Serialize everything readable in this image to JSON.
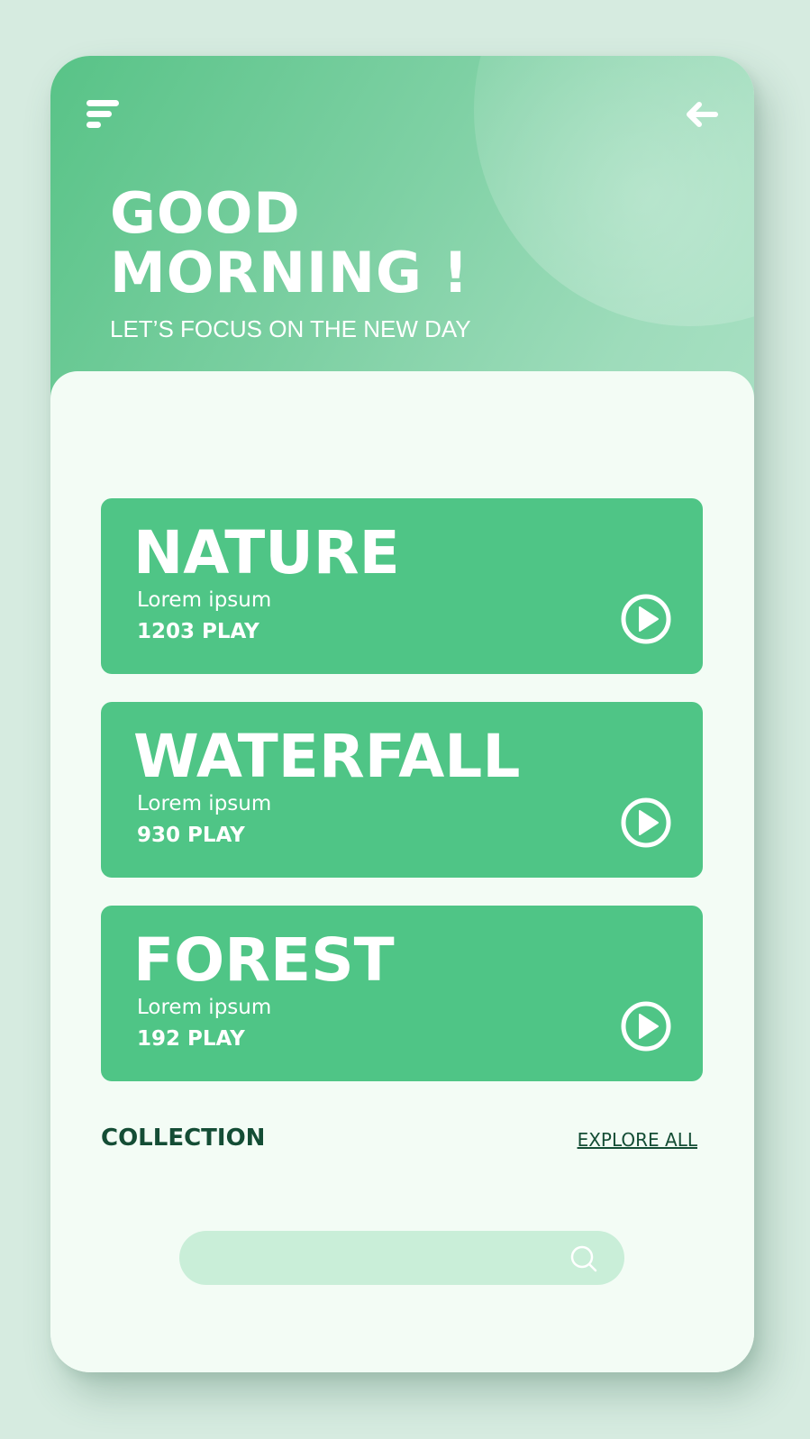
{
  "header": {
    "greeting_line1": "GOOD",
    "greeting_line2": "MORNING !",
    "subtitle": "LET’S FOCUS ON THE NEW DAY",
    "menu_icon": "menu-icon",
    "back_icon": "arrow-left-icon"
  },
  "cards": [
    {
      "title": "NATURE",
      "description": "Lorem ipsum",
      "plays": "1203 PLAY",
      "icon": "play-circle-icon"
    },
    {
      "title": "WATERFALL",
      "description": "Lorem ipsum",
      "plays": "930 PLAY",
      "icon": "play-circle-icon"
    },
    {
      "title": "FOREST",
      "description": "Lorem ipsum",
      "plays": "192 PLAY",
      "icon": "play-circle-icon"
    }
  ],
  "collection": {
    "title": "COLLECTION",
    "explore_label": "EXPLORE ALL"
  },
  "search": {
    "placeholder": "",
    "icon": "search-icon"
  },
  "colors": {
    "background": "#d6ebe0",
    "header_gradient_start": "#58c387",
    "header_gradient_end": "#a8e0c3",
    "card": "#4fc586",
    "content_background": "#f3fcf5",
    "search_background": "#c9eed8",
    "dark_text": "#144d35"
  }
}
